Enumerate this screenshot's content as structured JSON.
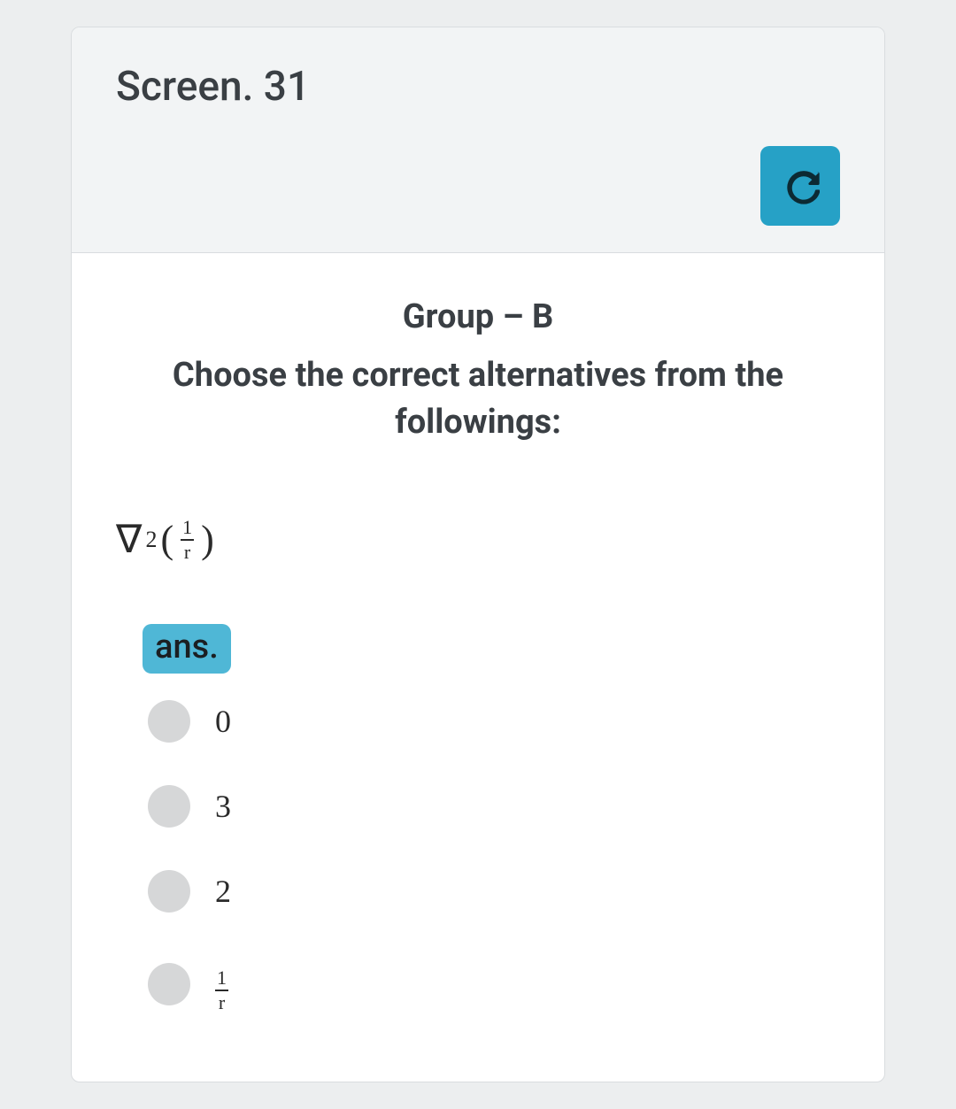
{
  "header": {
    "title": "Screen. 31"
  },
  "content": {
    "group_heading": "Group – B",
    "instruction": "Choose the correct alternatives from the followings:",
    "question": {
      "nabla": "∇",
      "sup": "2",
      "open_paren": "(",
      "frac_num": "1",
      "frac_den": "r",
      "close_paren": ")"
    },
    "ans_label": "ans.",
    "options": [
      {
        "type": "text",
        "value": "0"
      },
      {
        "type": "text",
        "value": "3"
      },
      {
        "type": "text",
        "value": "2"
      },
      {
        "type": "frac",
        "num": "1",
        "den": "r"
      }
    ]
  }
}
